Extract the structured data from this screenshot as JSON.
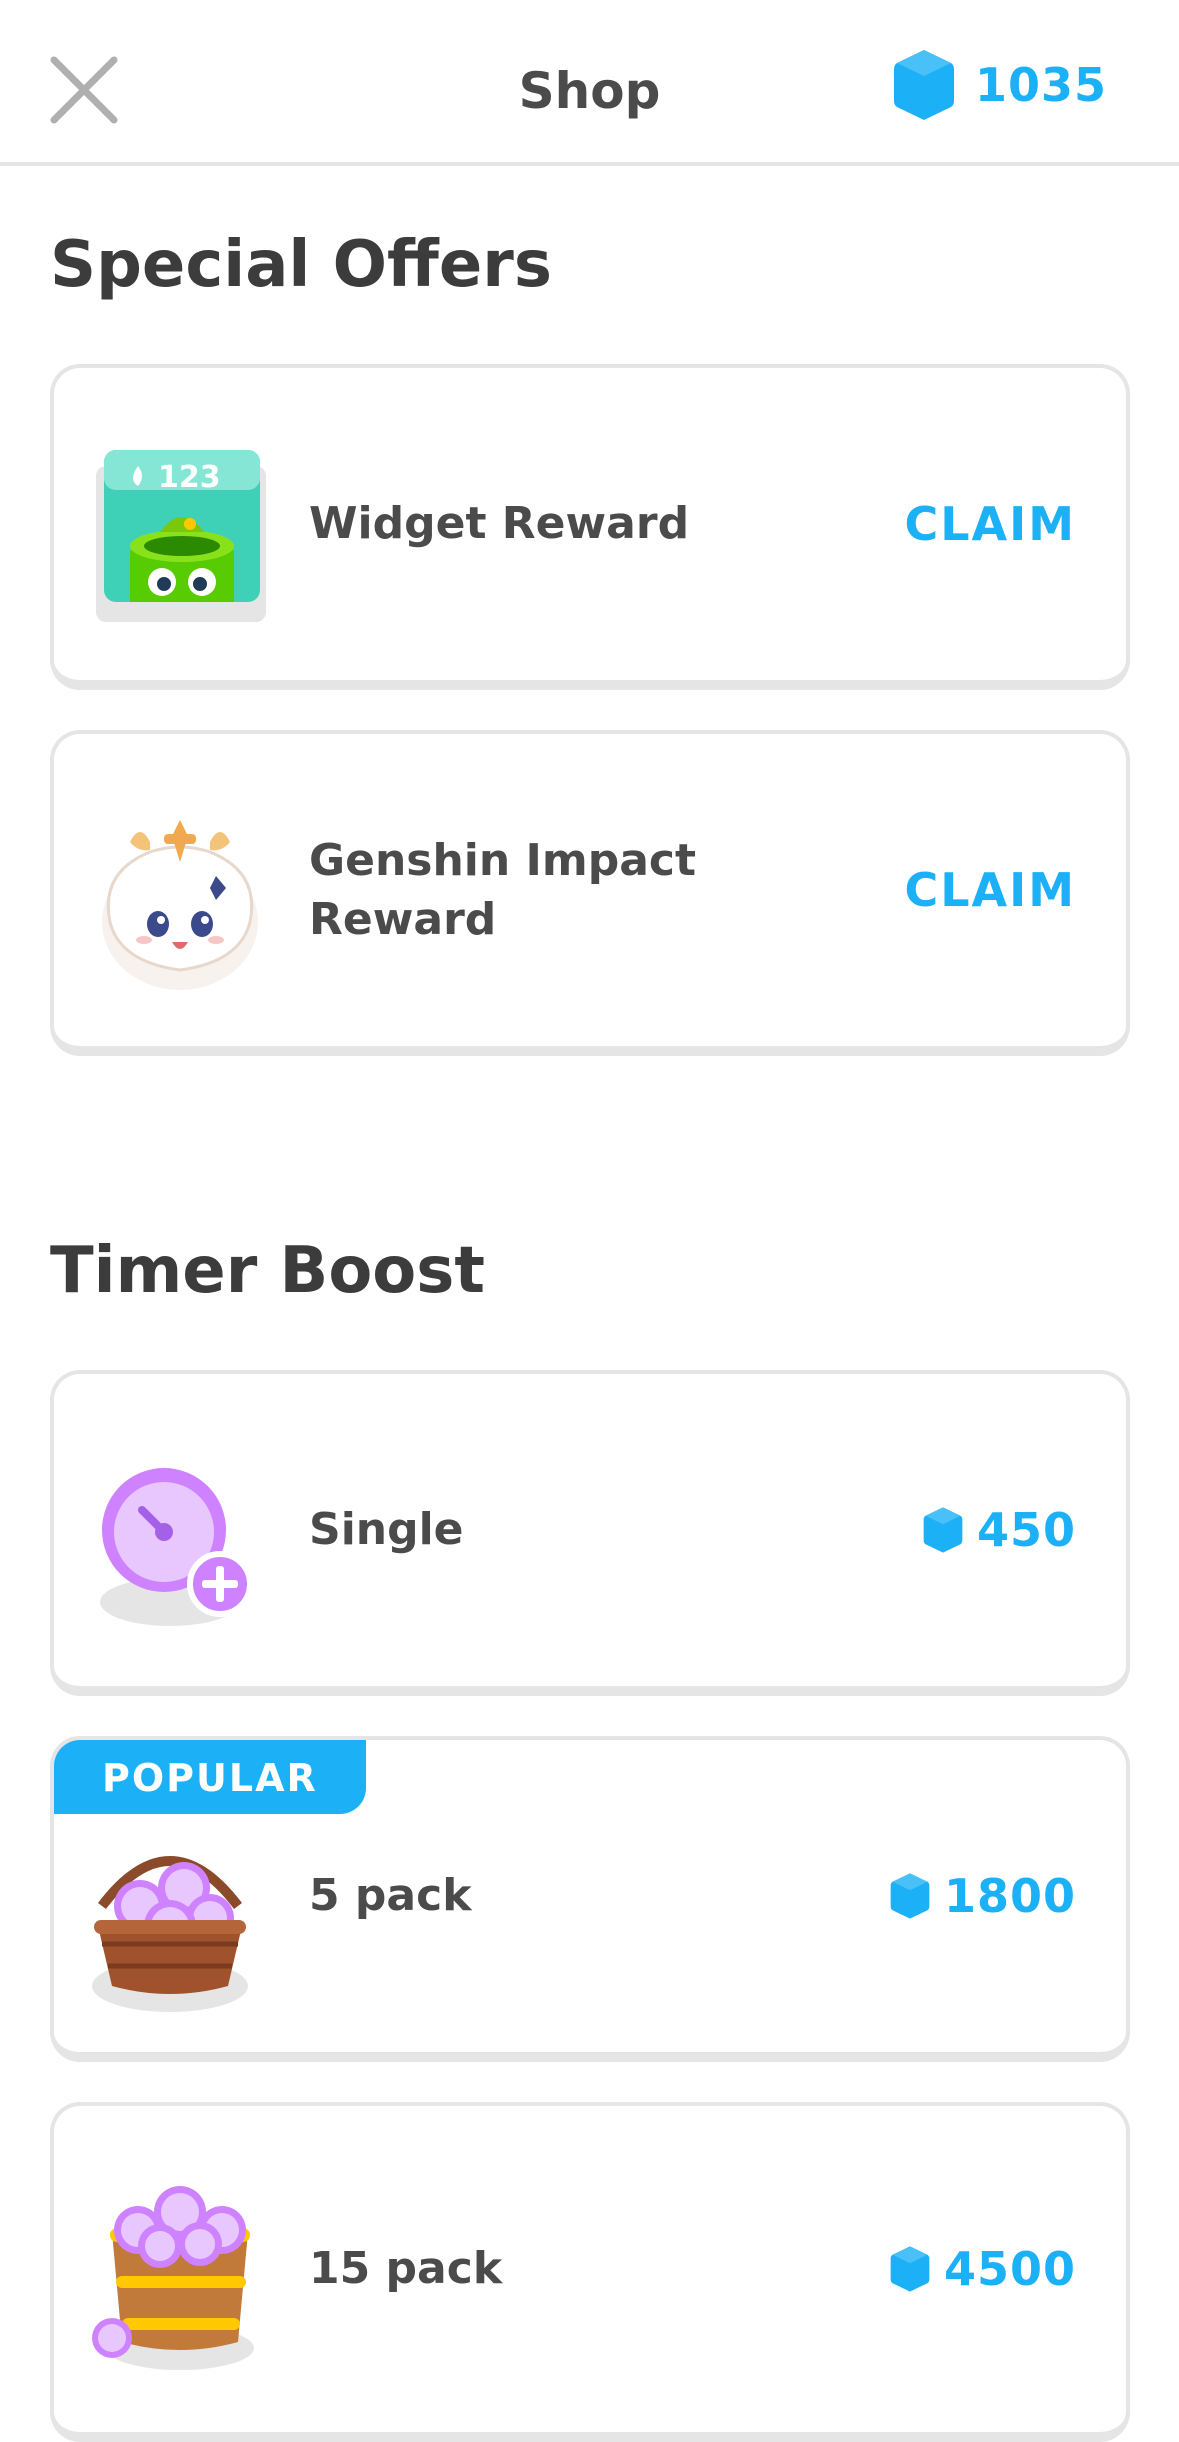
{
  "header": {
    "title": "Shop",
    "gem_count": "1035"
  },
  "special_offers": {
    "heading": "Special Offers",
    "items": [
      {
        "label": "Widget Reward",
        "action": "CLAIM",
        "widget_streak": "123"
      },
      {
        "label": "Genshin Impact Reward",
        "action": "CLAIM"
      }
    ]
  },
  "timer_boost": {
    "heading": "Timer Boost",
    "items": [
      {
        "label": "Single",
        "price": "450"
      },
      {
        "label": "5 pack",
        "price": "1800",
        "badge": "POPULAR"
      },
      {
        "label": "15 pack",
        "price": "4500"
      }
    ]
  },
  "colors": {
    "accent": "#1cb0f6",
    "text": "#4b4b4b",
    "border": "#e5e5e5",
    "timer": "#ce82ff"
  }
}
